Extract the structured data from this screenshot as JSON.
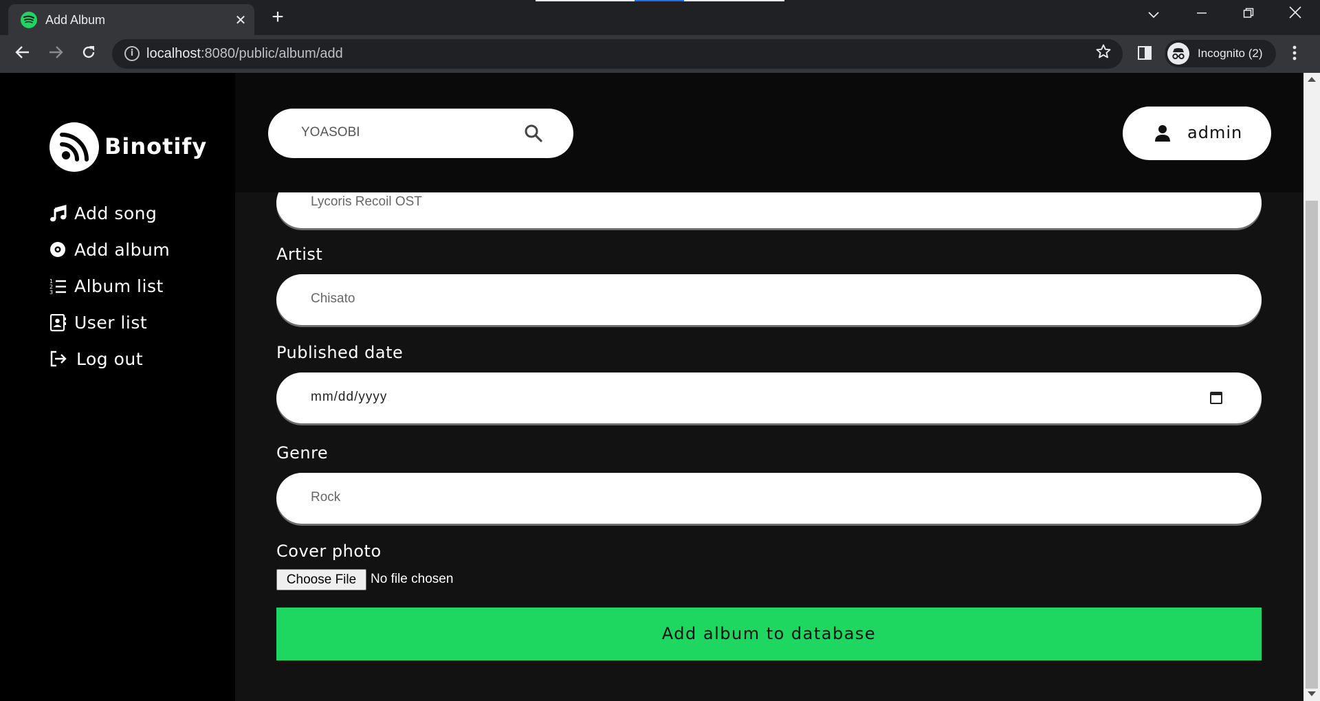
{
  "browser": {
    "tab_title": "Add Album",
    "url_host": "localhost",
    "url_path": ":8080/public/album/add",
    "profile_label": "Incognito (2)"
  },
  "colors": {
    "accent": "#1ed760",
    "sidebar_bg": "#000000",
    "main_bg": "#121212"
  },
  "sidebar": {
    "brand": "Binotify",
    "items": [
      {
        "label": "Add song",
        "icon": "music-note-icon"
      },
      {
        "label": "Add album",
        "icon": "disc-icon"
      },
      {
        "label": "Album list",
        "icon": "numbered-list-icon"
      },
      {
        "label": "User list",
        "icon": "contact-card-icon"
      },
      {
        "label": "Log out",
        "icon": "logout-icon"
      }
    ]
  },
  "header": {
    "search_value": "YOASOBI",
    "user_name": "admin"
  },
  "form": {
    "album_title_value": "Lycoris Recoil OST",
    "artist_label": "Artist",
    "artist_value": "Chisato",
    "date_label": "Published date",
    "date_placeholder": "mm/dd/yyyy",
    "genre_label": "Genre",
    "genre_value": "Rock",
    "cover_label": "Cover photo",
    "file_button": "Choose File",
    "file_status": "No file chosen",
    "submit_label": "Add album to database"
  }
}
